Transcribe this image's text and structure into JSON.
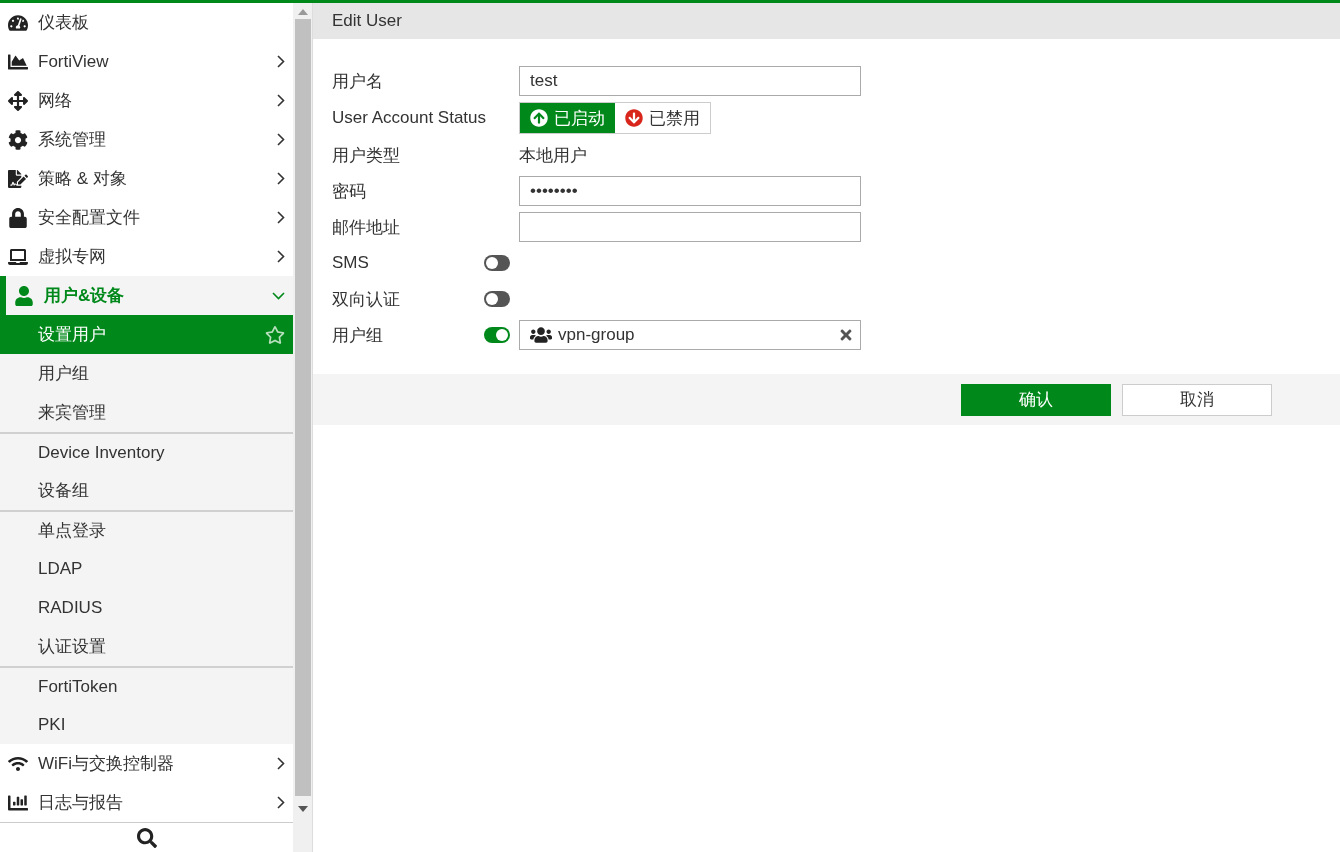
{
  "sidebar": {
    "items": [
      {
        "label": "仪表板",
        "has_submenu": false
      },
      {
        "label": "FortiView",
        "has_submenu": true
      },
      {
        "label": "网络",
        "has_submenu": true
      },
      {
        "label": "系统管理",
        "has_submenu": true
      },
      {
        "label": "策略 & 对象",
        "has_submenu": true
      },
      {
        "label": "安全配置文件",
        "has_submenu": true
      },
      {
        "label": "虚拟专网",
        "has_submenu": true
      },
      {
        "label": "用户&设备",
        "has_submenu": true,
        "expanded": true,
        "children": [
          {
            "label": "设置用户",
            "selected": true,
            "separated": false
          },
          {
            "label": "用户组",
            "selected": false,
            "separated": false
          },
          {
            "label": "来宾管理",
            "selected": false,
            "separated": false
          },
          {
            "label": "Device Inventory",
            "selected": false,
            "separated": true
          },
          {
            "label": "设备组",
            "selected": false,
            "separated": false
          },
          {
            "label": "单点登录",
            "selected": false,
            "separated": true
          },
          {
            "label": "LDAP",
            "selected": false,
            "separated": false
          },
          {
            "label": "RADIUS",
            "selected": false,
            "separated": false
          },
          {
            "label": "认证设置",
            "selected": false,
            "separated": false
          },
          {
            "label": "FortiToken",
            "selected": false,
            "separated": true
          },
          {
            "label": "PKI",
            "selected": false,
            "separated": false
          }
        ]
      },
      {
        "label": "WiFi与交换控制器",
        "has_submenu": true
      },
      {
        "label": "日志与报告",
        "has_submenu": true
      }
    ]
  },
  "panel": {
    "title": "Edit User",
    "fields": [
      {
        "kind": "input",
        "label": "用户名",
        "value": "test"
      },
      {
        "kind": "status",
        "label": "User Account Status",
        "options": [
          {
            "label": "已启动",
            "selected": true
          },
          {
            "label": "已禁用",
            "selected": false
          }
        ]
      },
      {
        "kind": "static",
        "label": "用户类型",
        "value": "本地用户"
      },
      {
        "kind": "input",
        "label": "密码",
        "value": "••••••••"
      },
      {
        "kind": "input",
        "label": "邮件地址"
      },
      {
        "kind": "switch",
        "label": "SMS",
        "on": false
      },
      {
        "kind": "switch",
        "label": "双向认证",
        "on": false
      },
      {
        "kind": "switch",
        "label": "用户组",
        "on": true,
        "tags": [
          "vpn-group"
        ]
      }
    ],
    "buttons": [
      {
        "label": "确认",
        "kind": "primary"
      },
      {
        "label": "取消",
        "kind": "secondary"
      }
    ]
  }
}
